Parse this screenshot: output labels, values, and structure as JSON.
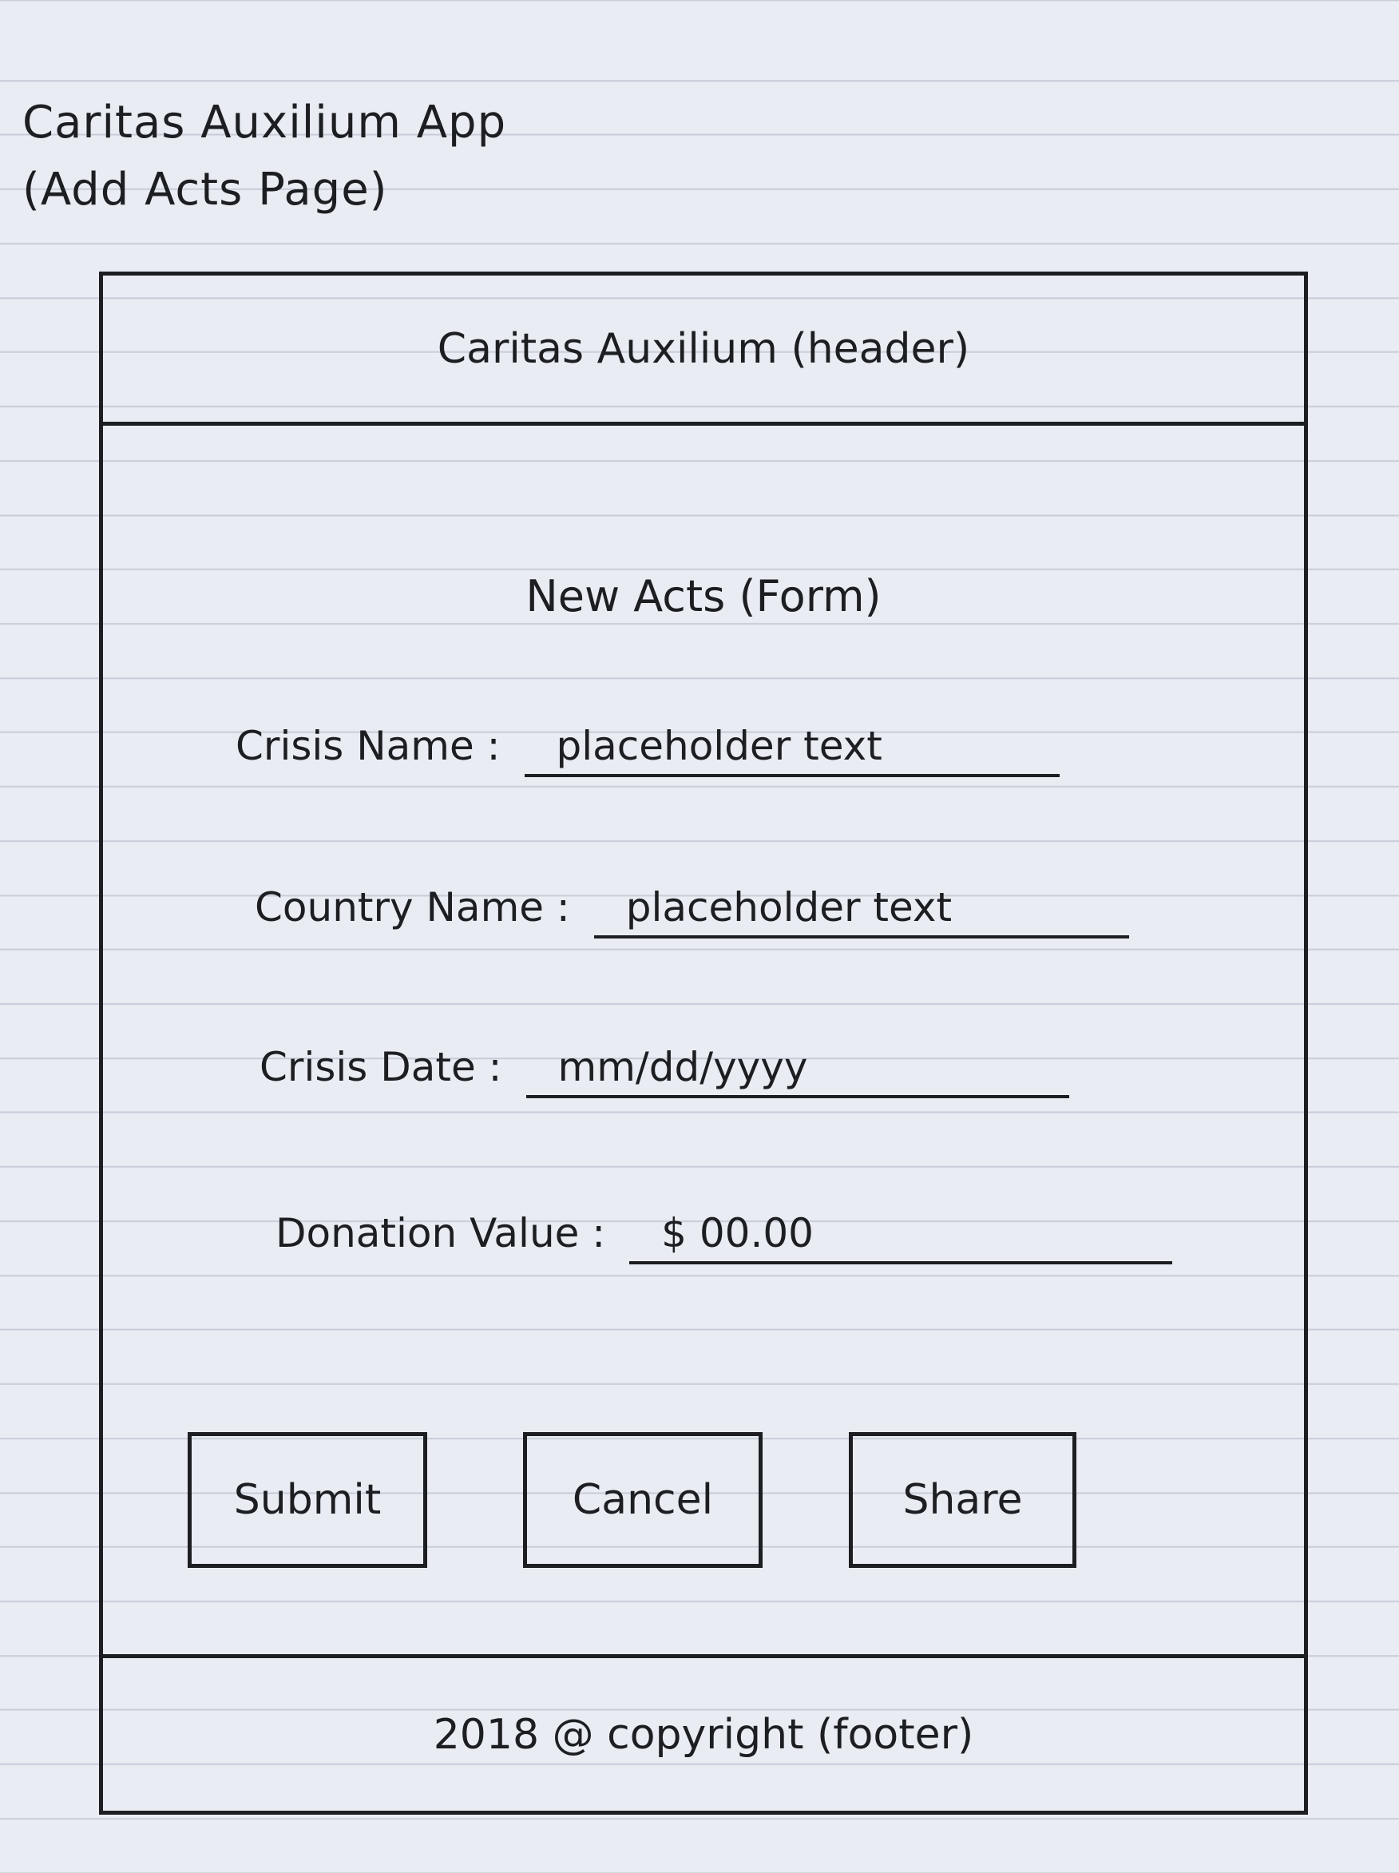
{
  "sketch": {
    "title_line1": "Caritas Auxilium App",
    "title_line2": "(Add Acts Page)"
  },
  "header": {
    "title": "Caritas Auxilium (header)"
  },
  "form": {
    "title": "New Acts (Form)",
    "fields": [
      {
        "label": "Crisis Name :",
        "placeholder": "placeholder text"
      },
      {
        "label": "Country Name :",
        "placeholder": "placeholder text"
      },
      {
        "label": "Crisis Date :",
        "placeholder": "mm/dd/yyyy"
      },
      {
        "label": "Donation Value :",
        "placeholder": "$ 00.00"
      }
    ]
  },
  "buttons": {
    "submit": "Submit",
    "cancel": "Cancel",
    "share": "Share"
  },
  "footer": {
    "text": "2018 @ copyright (footer)"
  }
}
